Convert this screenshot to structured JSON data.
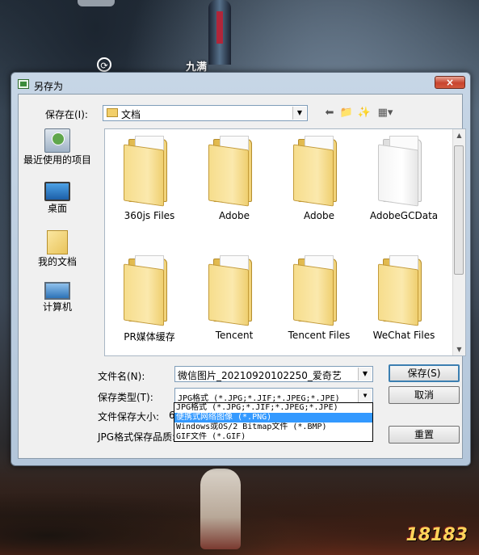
{
  "background": {
    "game_name": "九满",
    "watermark": "18183"
  },
  "window": {
    "title": "另存为",
    "close_symbol": "×"
  },
  "toolbar": {
    "save_in_label": "保存在(I):",
    "save_in_value": "文档",
    "icons": [
      "back-arrow-icon",
      "up-folder-icon",
      "new-folder-icon",
      "view-menu-icon"
    ]
  },
  "places": [
    {
      "label": "最近使用的项目",
      "icon": "recent-icon"
    },
    {
      "label": "桌面",
      "icon": "desktop-icon"
    },
    {
      "label": "我的文档",
      "icon": "documents-icon"
    },
    {
      "label": "计算机",
      "icon": "computer-icon"
    }
  ],
  "files": [
    {
      "name": "360js Files",
      "icon": "folder-icon"
    },
    {
      "name": "Adobe",
      "icon": "folder-icon"
    },
    {
      "name": "Adobe",
      "icon": "folder-icon"
    },
    {
      "name": "AdobeGCData",
      "icon": "white-folder-icon"
    },
    {
      "name": "PR媒体缓存",
      "icon": "folder-icon"
    },
    {
      "name": "Tencent",
      "icon": "folder-icon"
    },
    {
      "name": "Tencent Files",
      "icon": "folder-icon"
    },
    {
      "name": "WeChat Files",
      "icon": "folder-icon"
    }
  ],
  "form": {
    "filename_label": "文件名(N):",
    "filename_value": "微信图片_20210920102250_爱奇艺",
    "filetype_label": "保存类型(T):",
    "filetype_value": "JPG格式 (*.JPG;*.JIF;*.JPEG;*.JPE)",
    "filesize_label": "文件保存大小:",
    "filesize_value": "6",
    "quality_label": "JPG格式保存品质:",
    "save_button": "保存(S)",
    "cancel_button": "取消",
    "reset_button": "重置"
  },
  "filetype_options": [
    {
      "label": "JPG格式 (*.JPG;*.JIF;*.JPEG;*.JPE)",
      "selected": false
    },
    {
      "label": "便携式网络图像 (*.PNG)",
      "selected": true
    },
    {
      "label": "Windows或OS/2 Bitmap文件 (*.BMP)",
      "selected": false
    },
    {
      "label": "GIF文件 (*.GIF)",
      "selected": false
    }
  ]
}
